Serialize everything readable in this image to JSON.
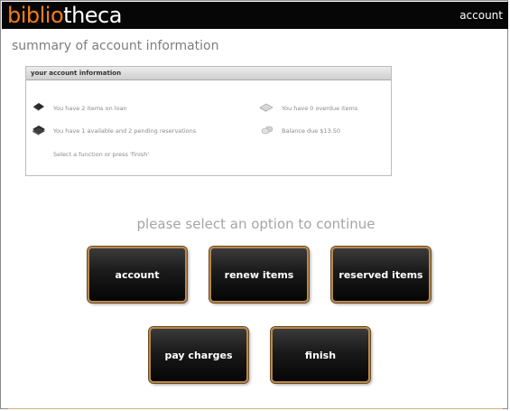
{
  "header": {
    "logo_part1": "biblio",
    "logo_part2": "theca",
    "account_link": "account"
  },
  "page": {
    "title": "summary of account information"
  },
  "account_panel": {
    "heading": "your account information",
    "items_on_loan": "You have 2 items on loan",
    "reservations": "You have 1 available and 2 pending reservations",
    "instruction": "Select a function or press 'finish'",
    "overdue": "You have 0 overdue items",
    "balance": "Balance due $13.50"
  },
  "options": {
    "prompt": "please select an option to continue",
    "buttons": {
      "account": "account",
      "renew": "renew items",
      "reserved": "reserved items",
      "pay": "pay charges",
      "finish": "finish"
    }
  },
  "colors": {
    "brand_orange": "#f07e16",
    "button_border": "#b6884f",
    "topbar": "#060606"
  },
  "icons": [
    "book-icon",
    "books-icon",
    "overdue-book-icon",
    "coins-icon"
  ]
}
